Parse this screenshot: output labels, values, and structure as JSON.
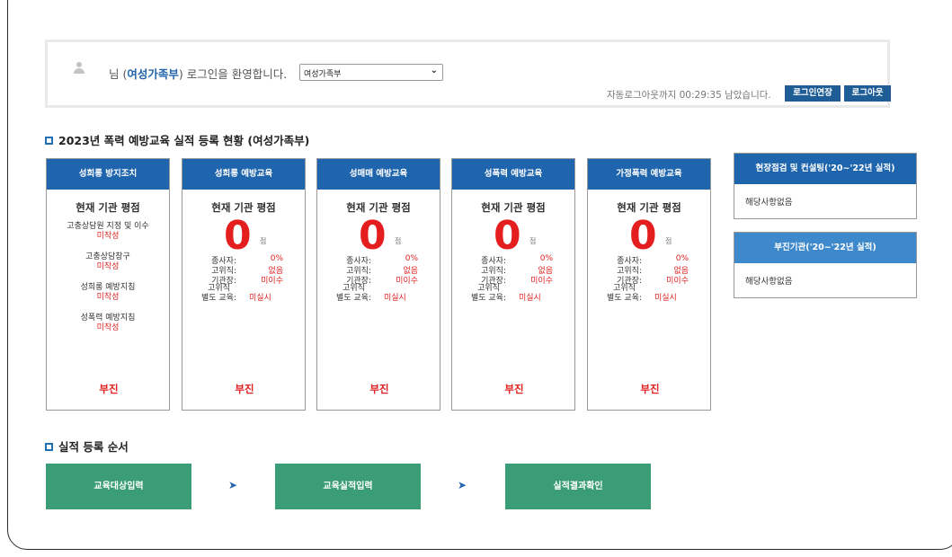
{
  "login": {
    "welcome_prefix": "님 (",
    "org_name": "여성가족부",
    "welcome_suffix": ") 로그인을 환영합니다.",
    "select_value": "여성가족부",
    "timer_text": "자동로그아웃까지 00:29:35 남았습니다.",
    "extend_button": "로그인연장",
    "logout_button": "로그아웃"
  },
  "section1_title": "2023년 폭력 예방교육 실적 등록 현황 (여성가족부)",
  "section2_title": "실적 등록 순서",
  "cards": [
    {
      "title": "성희롱 방지조치",
      "subtitle": "현재 기관 평점",
      "items": [
        {
          "label": "고충상담원 지정 및 이수",
          "value": "미작성"
        },
        {
          "label": "고충상담창구",
          "value": "미작성"
        },
        {
          "label": "성희롱 예방지침",
          "value": "미작성"
        },
        {
          "label": "성폭력 예방지침",
          "value": "미작성"
        }
      ],
      "status": "부진"
    },
    {
      "title": "성희롱 예방교육",
      "subtitle": "현재 기관 평점",
      "score": "0",
      "unit": "점",
      "stats": {
        "l1": "종사자:",
        "v1": "0%",
        "l2": "고위직:",
        "v2": "없음",
        "l3": "기관장:",
        "v3": "미이수",
        "l4a": "고위직",
        "l4b": "별도 교육:",
        "v4": "미실시"
      },
      "status": "부진"
    },
    {
      "title": "성매매 예방교육",
      "subtitle": "현재 기관 평점",
      "score": "0",
      "unit": "점",
      "stats": {
        "l1": "종사자:",
        "v1": "0%",
        "l2": "고위직:",
        "v2": "없음",
        "l3": "기관장:",
        "v3": "미이수",
        "l4a": "고위직",
        "l4b": "별도 교육:",
        "v4": "미실시"
      },
      "status": "부진"
    },
    {
      "title": "성폭력 예방교육",
      "subtitle": "현재 기관 평점",
      "score": "0",
      "unit": "점",
      "stats": {
        "l1": "종사자:",
        "v1": "0%",
        "l2": "고위직:",
        "v2": "없음",
        "l3": "기관장:",
        "v3": "미이수",
        "l4a": "고위직",
        "l4b": "별도 교육:",
        "v4": "미실시"
      },
      "status": "부진"
    },
    {
      "title": "가정폭력 예방교육",
      "subtitle": "현재 기관 평점",
      "score": "0",
      "unit": "점",
      "stats": {
        "l1": "종사자:",
        "v1": "0%",
        "l2": "고위직:",
        "v2": "없음",
        "l3": "기관장:",
        "v3": "미이수",
        "l4a": "고위직",
        "l4b": "별도 교육:",
        "v4": "미실시"
      },
      "status": "부진"
    }
  ],
  "side": [
    {
      "title": "현장점검 및 컨설팅('20~'22년 실적)",
      "body": "해당사항없음"
    },
    {
      "title": "부진기관('20~'22년 실적)",
      "body": "해당사항없음"
    }
  ],
  "steps": [
    "교육대상입력",
    "교육실적입력",
    "실적결과확인"
  ],
  "step_arrow": "➤",
  "colors": {
    "primary": "#1f65ad",
    "light_blue": "#3e88cc",
    "step_green": "#3a9d78",
    "alert_red": "#e02020"
  },
  "icons": {
    "avatar": "user-icon",
    "dropdown": "chevron-down-icon"
  }
}
